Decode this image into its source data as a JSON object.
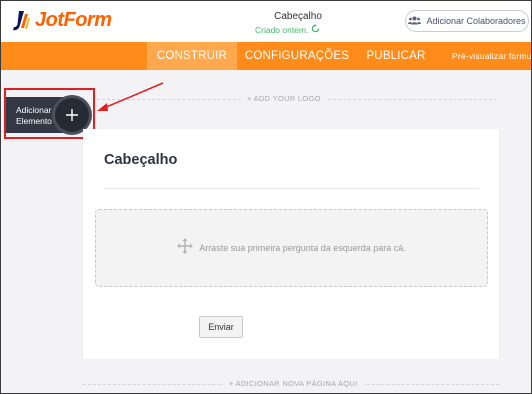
{
  "header": {
    "logo_text": "JotForm",
    "form_title": "Cabeçalho",
    "form_status": "Criado ontem.",
    "collaborators_label": "Adicionar Colaboradores"
  },
  "nav": {
    "tabs": [
      {
        "label": "CONSTRUIR",
        "active": true
      },
      {
        "label": "CONFIGURAÇÕES",
        "active": false
      },
      {
        "label": "PUBLICAR",
        "active": false
      }
    ],
    "preview_label": "Pré-visualizar formulá"
  },
  "builder": {
    "add_logo": "+ ADD YOUR LOGO",
    "add_element_label": "Adicionar Elemento",
    "add_page": "+ ADICIONAR NOVA PÁGINA AQUI"
  },
  "form": {
    "heading": "Cabeçalho",
    "drop_hint": "Arraste sua primeira pergunta da esquerda para cá.",
    "submit_label": "Enviar"
  },
  "colors": {
    "brand_orange": "#ff8c1a",
    "active_tab": "#ffa84e",
    "status_green": "#43b96a",
    "highlight_red": "#e02020"
  },
  "icons": [
    "jotform-logo-icon",
    "refresh-icon",
    "users-icon",
    "plus-icon",
    "move-arrows-icon",
    "red-arrow-annotation"
  ]
}
